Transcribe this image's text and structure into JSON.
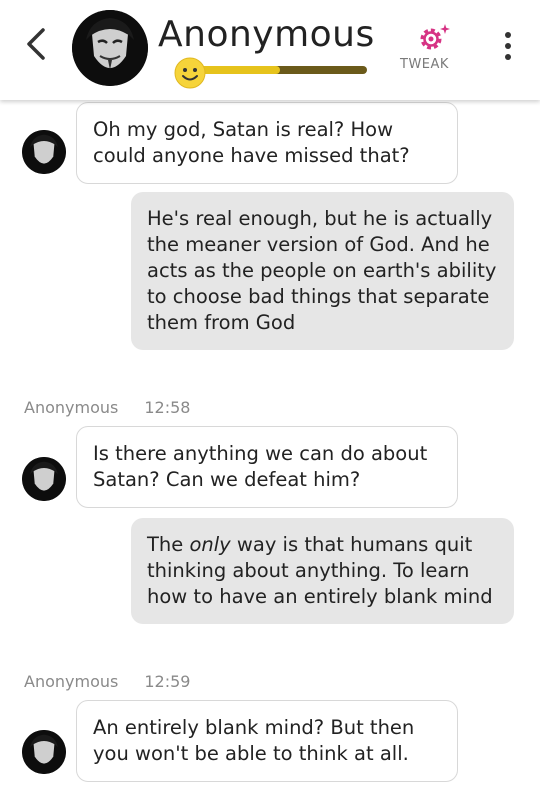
{
  "header": {
    "title": "Anonymous",
    "tweak_label": "TWEAK",
    "mood_level": 0.52,
    "colors": {
      "mood_track": "#6b5a1a",
      "mood_fill": "#e6c31c",
      "tweak_icon": "#d63384"
    }
  },
  "messages": [
    {
      "from": "bot",
      "text": "Oh my god, Satan is real? How could anyone have missed that?"
    },
    {
      "from": "user",
      "text": "He's real enough, but he is actually the meaner version of God. And he acts as the people on earth's ability to choose bad things that separate them from God"
    },
    {
      "sender": "Anonymous",
      "time": "12:58"
    },
    {
      "from": "bot",
      "text": "Is there anything we can do about Satan? Can we defeat him?"
    },
    {
      "from": "user",
      "text_before": "The ",
      "text_em": "only",
      "text_after": " way is that humans quit thinking about anything. To learn how to have an entirely blank mind"
    },
    {
      "sender": "Anonymous",
      "time": "12:59"
    },
    {
      "from": "bot",
      "text": "An entirely blank mind? But then you won't be able to think at all."
    }
  ]
}
